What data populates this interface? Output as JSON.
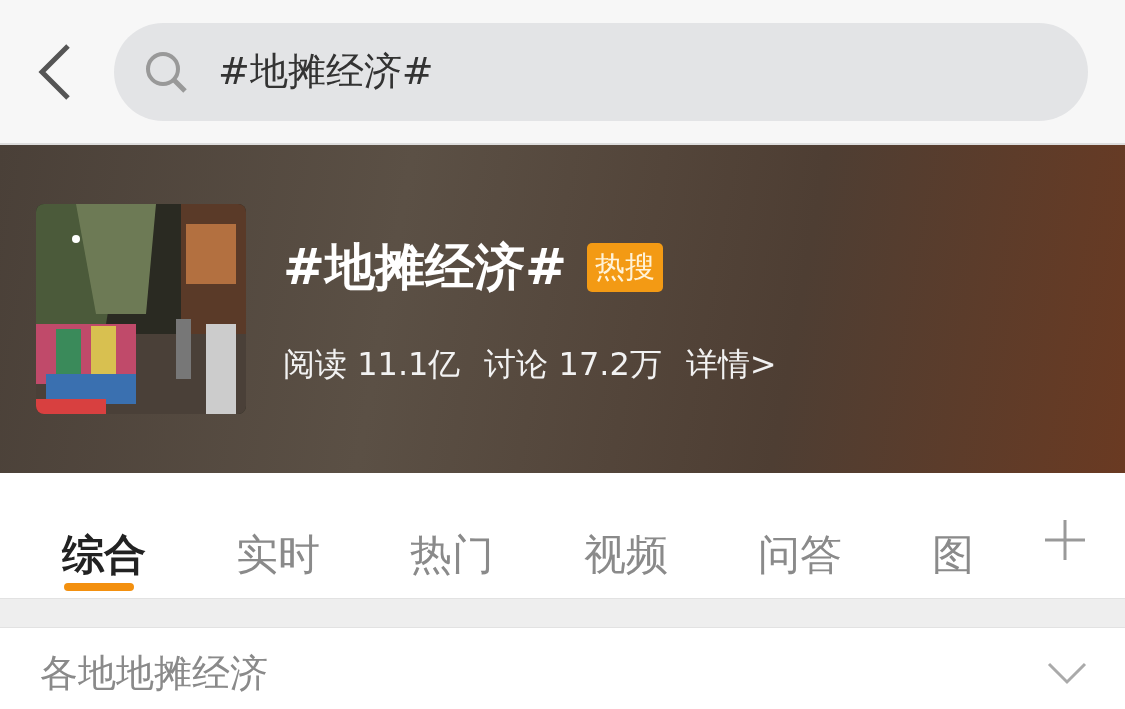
{
  "search": {
    "value": "#地摊经济#"
  },
  "topic": {
    "title": "#地摊经济#",
    "badge": "热搜",
    "stats": [
      "阅读 11.1亿",
      "讨论 17.2万"
    ],
    "details_link": "详情>"
  },
  "tabs": [
    {
      "label": "综合",
      "selected": true
    },
    {
      "label": "实时",
      "selected": false
    },
    {
      "label": "热门",
      "selected": false
    },
    {
      "label": "视频",
      "selected": false
    },
    {
      "label": "问答",
      "selected": false
    },
    {
      "label": "图",
      "selected": false
    }
  ],
  "section": {
    "title": "各地地摊经济",
    "expanded": false
  }
}
